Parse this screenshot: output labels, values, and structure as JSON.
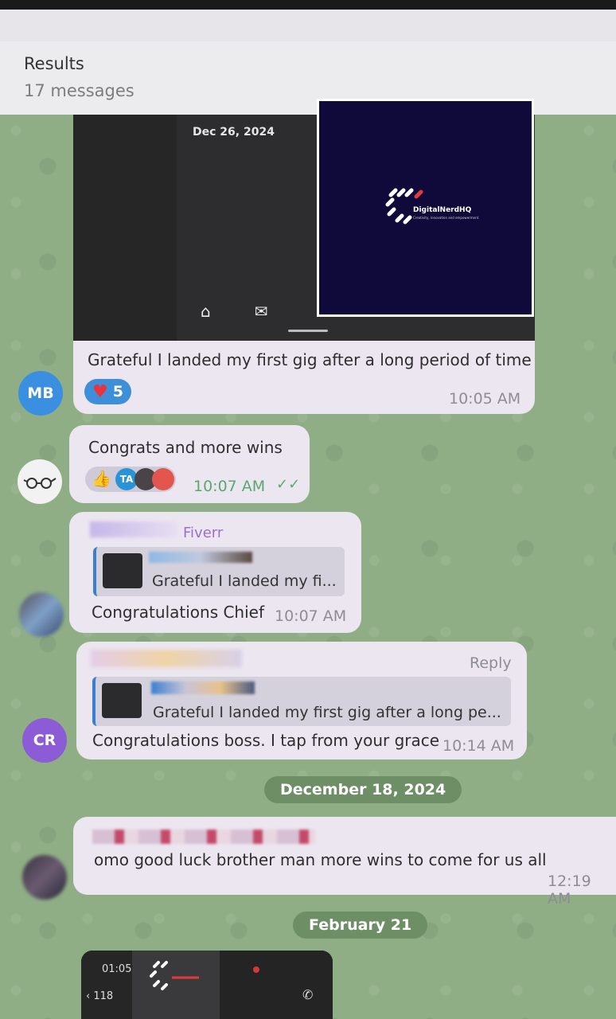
{
  "header": {
    "title": "Results",
    "count": "17 messages"
  },
  "messages": [
    {
      "sender_initials": "MB",
      "media_date": "Dec 26, 2024",
      "logo_brand": "DigitalNerdHQ",
      "logo_tagline": "Creativity, innovation and empowerment",
      "text": "Grateful I landed my first gig after a long period of time",
      "reaction_count": "5",
      "time": "10:05 AM"
    },
    {
      "text": "Congrats and more wins",
      "reactor_initials": "TA",
      "time": "10:07 AM"
    },
    {
      "sender_name": "Fiverr",
      "reply_quote": "Grateful I landed my fi...",
      "text": "Congratulations Chief",
      "time": "10:07 AM"
    },
    {
      "sender_initials": "CR",
      "reply_label": "Reply",
      "reply_quote": "Grateful I landed my first gig after a long pe...",
      "text": "Congratulations boss. I tap from your grace",
      "time": "10:14 AM"
    },
    {
      "text": "omo  good luck brother man more wins to come for us all",
      "time": "12:19 AM"
    }
  ],
  "dates": {
    "d1": "December 18, 2024",
    "d2": "February 21"
  },
  "bottom_media": {
    "time": "01:05",
    "back_count": "118"
  },
  "colors": {
    "bubble": "#ece6f0",
    "accent": "#3a7fd0",
    "chat_bg": "#8fae86",
    "date_chip": "#6e8f66"
  }
}
